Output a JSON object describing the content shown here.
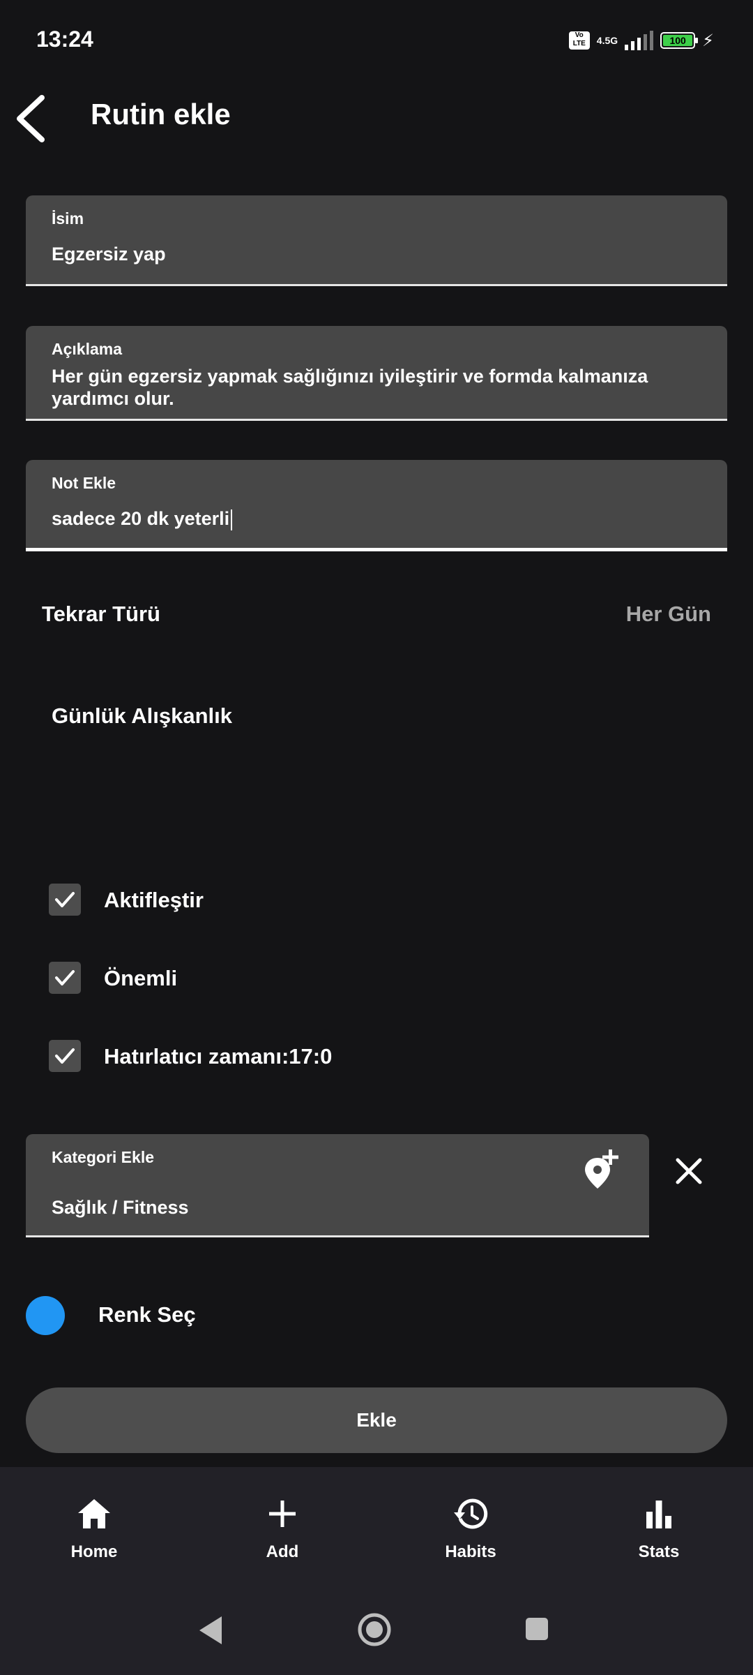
{
  "status_bar": {
    "time": "13:24",
    "volte": "Vo LTE",
    "network": "4.5G",
    "battery": "100"
  },
  "header": {
    "title": "Rutin ekle"
  },
  "form": {
    "name": {
      "label": "İsim",
      "value": "Egzersiz yap"
    },
    "description": {
      "label": "Açıklama",
      "value": "Her gün egzersiz yapmak sağlığınızı iyileştirir ve formda kalmanıza yardımcı olur."
    },
    "note": {
      "label": "Not Ekle",
      "value": "sadece 20 dk yeterli"
    },
    "repeat": {
      "label": "Tekrar Türü",
      "value": "Her Gün"
    },
    "habit_type": "Günlük Alışkanlık",
    "checkboxes": [
      {
        "label": "Aktifleştir",
        "checked": true
      },
      {
        "label": "Önemli",
        "checked": true
      },
      {
        "label": "Hatırlatıcı zamanı:17:0",
        "checked": true
      }
    ],
    "category": {
      "label": "Kategori Ekle",
      "value": "Sağlık / Fitness"
    },
    "color": {
      "label": "Renk Seç",
      "value": "#2196F3"
    },
    "submit_label": "Ekle"
  },
  "bottom_nav": [
    {
      "label": "Home",
      "icon": "home-icon"
    },
    {
      "label": "Add",
      "icon": "add-icon"
    },
    {
      "label": "Habits",
      "icon": "history-icon"
    },
    {
      "label": "Stats",
      "icon": "bar-chart-icon"
    }
  ]
}
